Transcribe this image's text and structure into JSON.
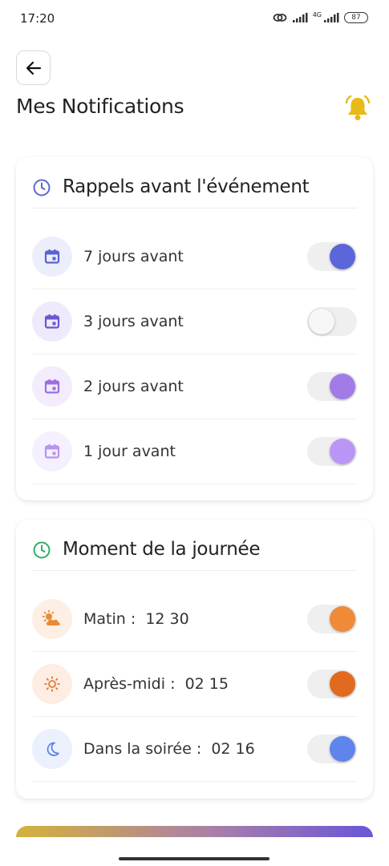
{
  "status_bar": {
    "time": "17:20",
    "network": "4G",
    "battery": "87"
  },
  "header": {
    "title": "Mes Notifications",
    "back_icon": "arrow-left-icon",
    "bell_icon": "bell-icon",
    "bell_color": "#E8B917"
  },
  "reminders": {
    "title": "Rappels avant l'événement",
    "title_icon": "clock-icon",
    "title_icon_color": "#5E66D6",
    "items": [
      {
        "label": "7 jours avant",
        "icon": "calendar-icon",
        "enabled": true,
        "icon_color": "#5B63D3",
        "icon_bg": "#ECEEFB",
        "knob_color": "#5B66DA"
      },
      {
        "label": "3 jours avant",
        "icon": "calendar-icon",
        "enabled": false,
        "icon_color": "#6E56CF",
        "icon_bg": "#EFEAFB",
        "knob_color": "#F7F7F7"
      },
      {
        "label": "2 jours avant",
        "icon": "calendar-icon",
        "enabled": true,
        "icon_color": "#9B6FE0",
        "icon_bg": "#F2ECFC",
        "knob_color": "#A27BE8"
      },
      {
        "label": "1 jour avant",
        "icon": "calendar-icon",
        "enabled": true,
        "icon_color": "#B993F0",
        "icon_bg": "#F5F0FD",
        "knob_color": "#B996F5"
      }
    ]
  },
  "moments": {
    "title": "Moment de la journée",
    "title_icon": "clock-icon",
    "title_icon_color": "#2FAE66",
    "items": [
      {
        "label": "Matin :",
        "time": "12 30",
        "icon": "sun-cloud-icon",
        "enabled": true,
        "icon_color": "#EA8A36",
        "icon_bg": "#FDEFE3",
        "knob_color": "#EE8A38"
      },
      {
        "label": "Après-midi :",
        "time": "02 15",
        "icon": "sun-icon",
        "enabled": true,
        "icon_color": "#E36A24",
        "icon_bg": "#FDEDE3",
        "knob_color": "#E26A1F"
      },
      {
        "label": "Dans la soirée :",
        "time": "02 16",
        "icon": "moon-icon",
        "enabled": true,
        "icon_color": "#5C7EE6",
        "icon_bg": "#EBF0FD",
        "knob_color": "#5F84EC"
      }
    ]
  }
}
